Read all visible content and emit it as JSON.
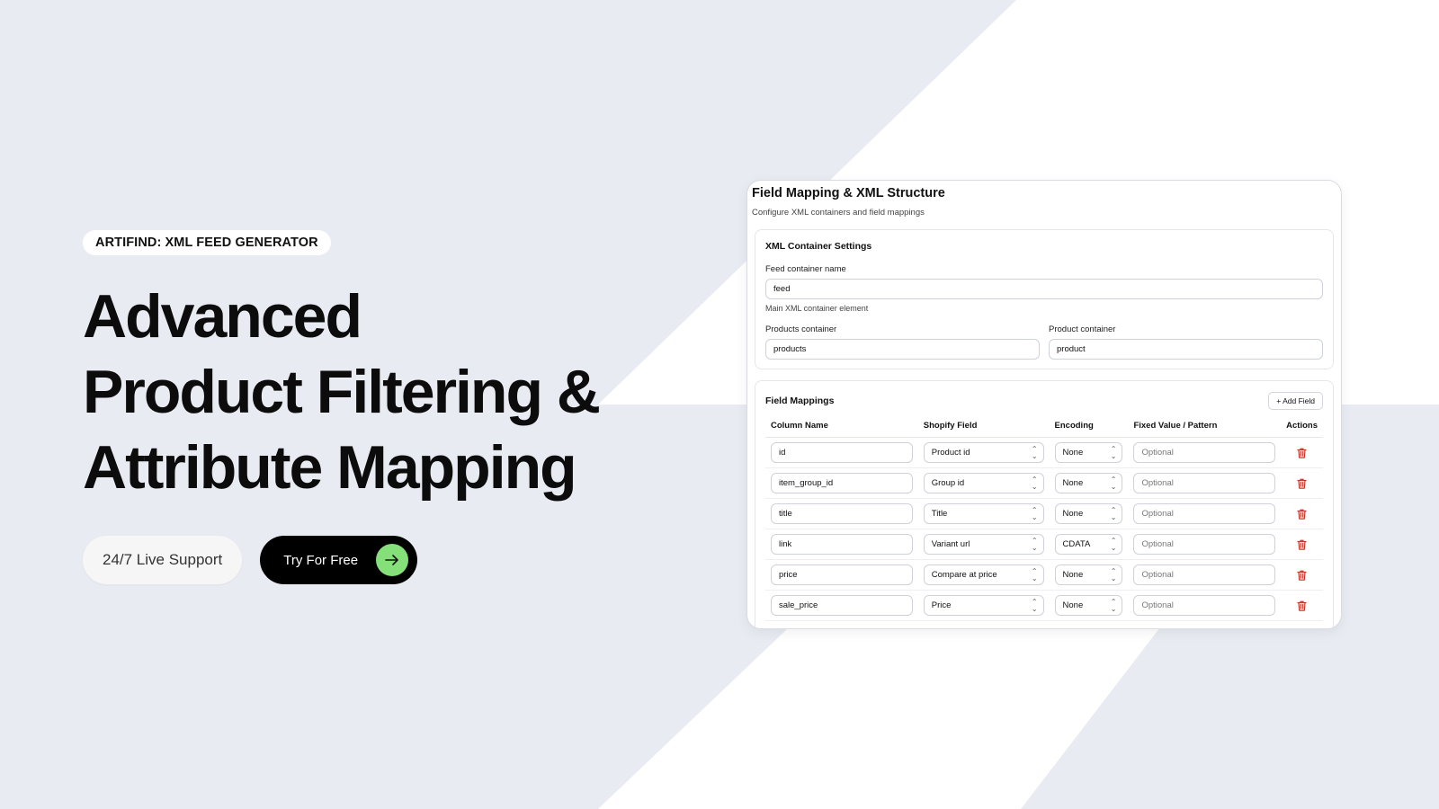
{
  "hero": {
    "tag": "ARTIFIND: XML FEED GENERATOR",
    "headline": [
      "Advanced",
      "Product Filtering &",
      "Attribute Mapping"
    ],
    "support_label": "24/7 Live Support",
    "try_label": "Try For Free"
  },
  "colors": {
    "background": "#e8ebf2",
    "accent_green": "#86e07a",
    "trash_red": "#c0392b"
  },
  "card": {
    "title": "Field Mapping & XML Structure",
    "subtitle": "Configure XML containers and field mappings",
    "xml_settings": {
      "title": "XML Container Settings",
      "feed_label": "Feed container name",
      "feed_value": "feed",
      "feed_hint": "Main XML container element",
      "products_label": "Products container",
      "products_value": "products",
      "product_label": "Product container",
      "product_value": "product"
    },
    "mappings": {
      "title": "Field Mappings",
      "add_label": "+ Add Field",
      "columns": [
        "Column Name",
        "Shopify Field",
        "Encoding",
        "Fixed Value / Pattern",
        "Actions"
      ],
      "rows": [
        {
          "column": "id",
          "field": "Product id",
          "encoding": "None",
          "fixed": "Optional"
        },
        {
          "column": "item_group_id",
          "field": "Group id",
          "encoding": "None",
          "fixed": "Optional"
        },
        {
          "column": "title",
          "field": "Title",
          "encoding": "None",
          "fixed": "Optional"
        },
        {
          "column": "link",
          "field": "Variant url",
          "encoding": "CDATA",
          "fixed": "Optional"
        },
        {
          "column": "price",
          "field": "Compare at price",
          "encoding": "None",
          "fixed": "Optional"
        },
        {
          "column": "sale_price",
          "field": "Price",
          "encoding": "None",
          "fixed": "Optional"
        }
      ]
    }
  }
}
